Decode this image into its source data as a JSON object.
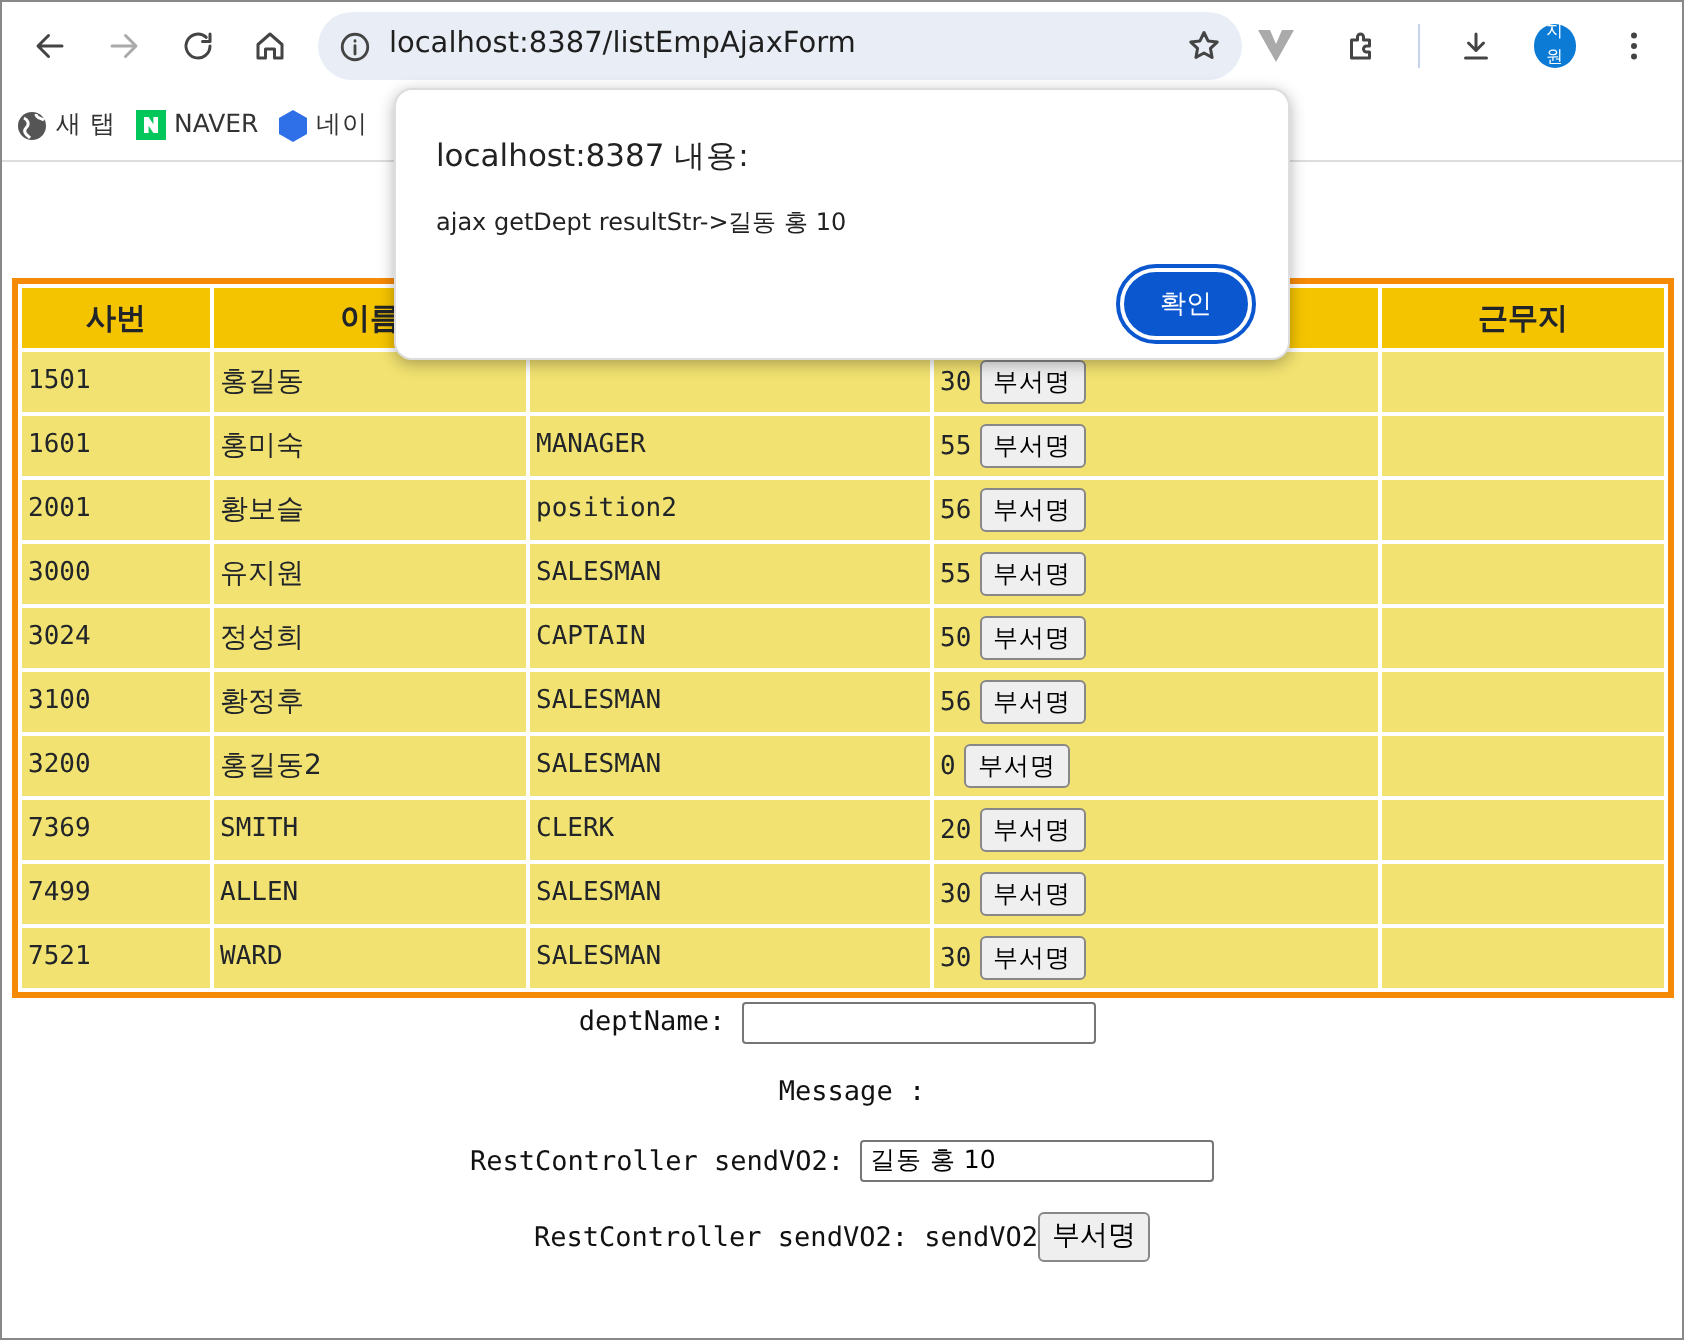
{
  "browser": {
    "back_disabled": false,
    "forward_disabled": true,
    "url": "localhost:8387/listEmpAjaxForm",
    "profile": "지원",
    "bookmarks": [
      {
        "label": "새 탭",
        "kind": "globe"
      },
      {
        "label": "NAVER",
        "kind": "naver"
      },
      {
        "label": "네이",
        "kind": "hex"
      }
    ]
  },
  "alert": {
    "title": "localhost:8387 내용:",
    "message": "ajax getDept resultStr->길동 홍 10",
    "button": "확인"
  },
  "table": {
    "columns": [
      {
        "label": "사번"
      },
      {
        "label": "이름"
      },
      {},
      {},
      {
        "label": "근무지"
      }
    ],
    "rows": [
      {
        "empno": "1501",
        "name": "홍길동",
        "dept": "30",
        "button": "부서명"
      },
      {
        "empno": "1601",
        "name": "홍미숙",
        "position": "MANAGER",
        "dept": "55",
        "button": "부서명"
      },
      {
        "empno": "2001",
        "name": "황보슬",
        "position": "position2",
        "dept": "56",
        "button": "부서명"
      },
      {
        "empno": "3000",
        "name": "유지원",
        "position": "SALESMAN",
        "dept": "55",
        "button": "부서명"
      },
      {
        "empno": "3024",
        "name": "정성희",
        "position": "CAPTAIN",
        "dept": "50",
        "button": "부서명"
      },
      {
        "empno": "3100",
        "name": "황정후",
        "position": "SALESMAN",
        "dept": "56",
        "button": "부서명"
      },
      {
        "empno": "3200",
        "name": "홍길동2",
        "position": "SALESMAN",
        "dept": "0",
        "button": "부서명"
      },
      {
        "empno": "7369",
        "name": "SMITH",
        "position": "CLERK",
        "dept": "20",
        "button": "부서명"
      },
      {
        "empno": "7499",
        "name": "ALLEN",
        "position": "SALESMAN",
        "dept": "30",
        "button": "부서명"
      },
      {
        "empno": "7521",
        "name": "WARD",
        "position": "SALESMAN",
        "dept": "30",
        "button": "부서명"
      }
    ]
  },
  "form": {
    "dept_label": "deptName:",
    "message_label": "Message :",
    "vo2_label": "RestController sendVO2:",
    "vo2_value": "길동 홍 10",
    "vo2_text": "RestController sendVO2: sendVO2",
    "vo2_button": "부서명"
  }
}
